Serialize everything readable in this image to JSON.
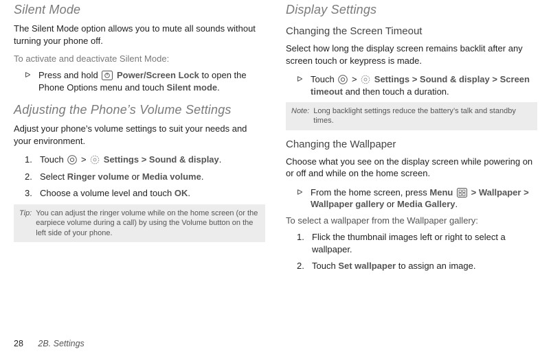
{
  "left": {
    "h_silent": "Silent Mode",
    "silent_body": "The Silent Mode option allows you to mute all sounds without turning your phone off.",
    "silent_lead": "To activate and deactivate Silent Mode:",
    "silent_step_pre": "Press and hold ",
    "silent_step_bold1": "Power/Screen Lock",
    "silent_step_mid": " to open the Phone Options menu and touch ",
    "silent_step_bold2": "Silent mode",
    "silent_step_post": ".",
    "h_volume": "Adjusting the Phone’s Volume Settings",
    "volume_body": "Adjust your phone’s volume settings to suit your needs and your environment.",
    "vol_s1_pre": "Touch ",
    "vol_s1_gt1": " > ",
    "vol_s1_bold1": "Settings",
    "vol_s1_gt2": " > ",
    "vol_s1_bold2": "Sound & display",
    "vol_s1_post": ".",
    "vol_s2_pre": "Select ",
    "vol_s2_bold1": "Ringer volume",
    "vol_s2_mid": " or ",
    "vol_s2_bold2": "Media volume",
    "vol_s2_post": ".",
    "vol_s3_pre": "Choose a volume level and touch ",
    "vol_s3_bold": "OK",
    "vol_s3_post": ".",
    "tip_tag": "Tip:",
    "tip_msg": "You can adjust the ringer volume while on the home screen (or the earpiece volume during a call) by using the Volume button on the left side of your phone."
  },
  "right": {
    "h_display": "Display Settings",
    "h_timeout": "Changing the Screen Timeout",
    "timeout_body": "Select how long the display screen remains backlit after any screen touch or keypress is made.",
    "to_s1_pre": "Touch ",
    "to_s1_gt1": " > ",
    "to_s1_bold1": "Settings",
    "to_s1_gt2": " > ",
    "to_s1_bold2": "Sound & display",
    "to_s1_gt3": " > ",
    "to_s1_bold3": "Screen timeout",
    "to_s1_post": " and then touch a duration.",
    "note_tag": "Note:",
    "note_msg": "Long backlight settings reduce the battery’s talk and standby times.",
    "h_wall": "Changing the Wallpaper",
    "wall_body": "Choose what you see on the display screen while powering on or off and while on the home screen.",
    "wall_s1_pre": "From the home screen, press ",
    "wall_s1_bold1": "Menu",
    "wall_s1_gt1": " > ",
    "wall_s1_bold2": "Wallpaper",
    "wall_s1_gt2": " > ",
    "wall_s1_bold3": "Wallpaper gallery",
    "wall_s1_mid": " or ",
    "wall_s1_bold4": "Media Gallery",
    "wall_s1_post": ".",
    "wall_lead": "To select a wallpaper from the Wallpaper gallery:",
    "wall_ol1": "Flick the thumbnail images left or right to select a wallpaper.",
    "wall_ol2_pre": "Touch ",
    "wall_ol2_bold": "Set wallpaper",
    "wall_ol2_post": " to assign an image."
  },
  "footer": {
    "page": "28",
    "crumb": "2B. Settings"
  },
  "nums": {
    "n1": "1.",
    "n2": "2.",
    "n3": "3."
  }
}
